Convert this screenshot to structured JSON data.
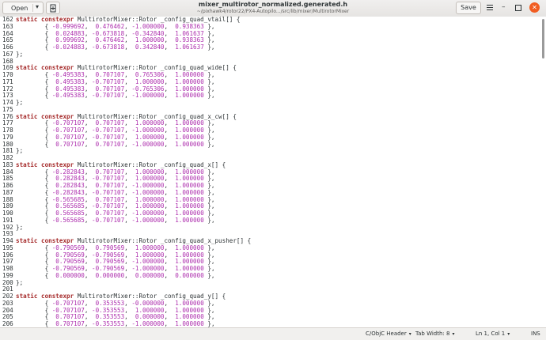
{
  "header": {
    "open_label": "Open",
    "open_chevron": "▾",
    "pin_icon": "document-new-icon",
    "title": "mixer_multirotor_normalized.generated.h",
    "subtitle": "~/pixhawk4/rotor22/PX4-Autopilo.../src/lib/mixer/MultirotorMixer",
    "save_label": "Save",
    "menu_icon": "hamburger-menu-icon",
    "minimize_icon": "–",
    "maximize_icon": "maximize-icon",
    "close_icon": "✕"
  },
  "code": {
    "lines": [
      {
        "n": "162",
        "code": "static constexpr MultirotorMixer::Rotor _config_quad_vtail[] {"
      },
      {
        "n": "163",
        "code": "        { -0.999692,  0.476462, -1.000000,  0.938363 },"
      },
      {
        "n": "164",
        "code": "        {  0.024883, -0.673818, -0.342840,  1.061637 },"
      },
      {
        "n": "165",
        "code": "        {  0.999692,  0.476462,  1.000000,  0.938363 },"
      },
      {
        "n": "166",
        "code": "        { -0.024883, -0.673818,  0.342840,  1.061637 },"
      },
      {
        "n": "167",
        "code": "};"
      },
      {
        "n": "168",
        "code": ""
      },
      {
        "n": "169",
        "code": "static constexpr MultirotorMixer::Rotor _config_quad_wide[] {"
      },
      {
        "n": "170",
        "code": "        { -0.495383,  0.707107,  0.765306,  1.000000 },"
      },
      {
        "n": "171",
        "code": "        {  0.495383, -0.707107,  1.000000,  1.000000 },"
      },
      {
        "n": "172",
        "code": "        {  0.495383,  0.707107, -0.765306,  1.000000 },"
      },
      {
        "n": "173",
        "code": "        { -0.495383, -0.707107, -1.000000,  1.000000 },"
      },
      {
        "n": "174",
        "code": "};"
      },
      {
        "n": "175",
        "code": ""
      },
      {
        "n": "176",
        "code": "static constexpr MultirotorMixer::Rotor _config_quad_x_cw[] {"
      },
      {
        "n": "177",
        "code": "        { -0.707107,  0.707107,  1.000000,  1.000000 },"
      },
      {
        "n": "178",
        "code": "        { -0.707107, -0.707107, -1.000000,  1.000000 },"
      },
      {
        "n": "179",
        "code": "        {  0.707107, -0.707107,  1.000000,  1.000000 },"
      },
      {
        "n": "180",
        "code": "        {  0.707107,  0.707107, -1.000000,  1.000000 },"
      },
      {
        "n": "181",
        "code": "};"
      },
      {
        "n": "182",
        "code": ""
      },
      {
        "n": "183",
        "code": "static constexpr MultirotorMixer::Rotor _config_quad_x[] {"
      },
      {
        "n": "184",
        "code": "        { -0.282843,  0.707107,  1.000000,  1.000000 },"
      },
      {
        "n": "185",
        "code": "        {  0.282843, -0.707107,  1.000000,  1.000000 },"
      },
      {
        "n": "186",
        "code": "        {  0.282843,  0.707107, -1.000000,  1.000000 },"
      },
      {
        "n": "187",
        "code": "        { -0.282843, -0.707107, -1.000000,  1.000000 },"
      },
      {
        "n": "188",
        "code": "        { -0.565685,  0.707107,  1.000000,  1.000000 },"
      },
      {
        "n": "189",
        "code": "        {  0.565685, -0.707107,  1.000000,  1.000000 },"
      },
      {
        "n": "190",
        "code": "        {  0.565685,  0.707107, -1.000000,  1.000000 },"
      },
      {
        "n": "191",
        "code": "        { -0.565685, -0.707107, -1.000000,  1.000000 },"
      },
      {
        "n": "192",
        "code": "};"
      },
      {
        "n": "193",
        "code": ""
      },
      {
        "n": "194",
        "code": "static constexpr MultirotorMixer::Rotor _config_quad_x_pusher[] {"
      },
      {
        "n": "195",
        "code": "        { -0.790569,  0.790569,  1.000000,  1.000000 },"
      },
      {
        "n": "196",
        "code": "        {  0.790569, -0.790569,  1.000000,  1.000000 },"
      },
      {
        "n": "197",
        "code": "        {  0.790569,  0.790569, -1.000000,  1.000000 },"
      },
      {
        "n": "198",
        "code": "        { -0.790569, -0.790569, -1.000000,  1.000000 },"
      },
      {
        "n": "199",
        "code": "        {  0.000000,  0.000000,  0.000000,  0.000000 },"
      },
      {
        "n": "200",
        "code": "};"
      },
      {
        "n": "201",
        "code": ""
      },
      {
        "n": "202",
        "code": "static constexpr MultirotorMixer::Rotor _config_quad_y[] {"
      },
      {
        "n": "203",
        "code": "        { -0.707107,  0.353553, -0.000000,  1.000000 },"
      },
      {
        "n": "204",
        "code": "        { -0.707107, -0.353553,  1.000000,  1.000000 },"
      },
      {
        "n": "205",
        "code": "        {  0.707107,  0.353553,  0.000000,  1.000000 },"
      },
      {
        "n": "206",
        "code": "        {  0.707107, -0.353553, -1.000000,  1.000000 },"
      },
      {
        "n": "207",
        "code": "};"
      }
    ]
  },
  "status": {
    "language": "C/ObjC Header",
    "tab_width": "Tab Width: 8",
    "position": "Ln 1, Col 1",
    "mode": "INS",
    "chevron": "▾"
  },
  "colors": {
    "keyword": "#a52a2a",
    "number": "#ad2dad",
    "close_button": "#f15d22"
  }
}
